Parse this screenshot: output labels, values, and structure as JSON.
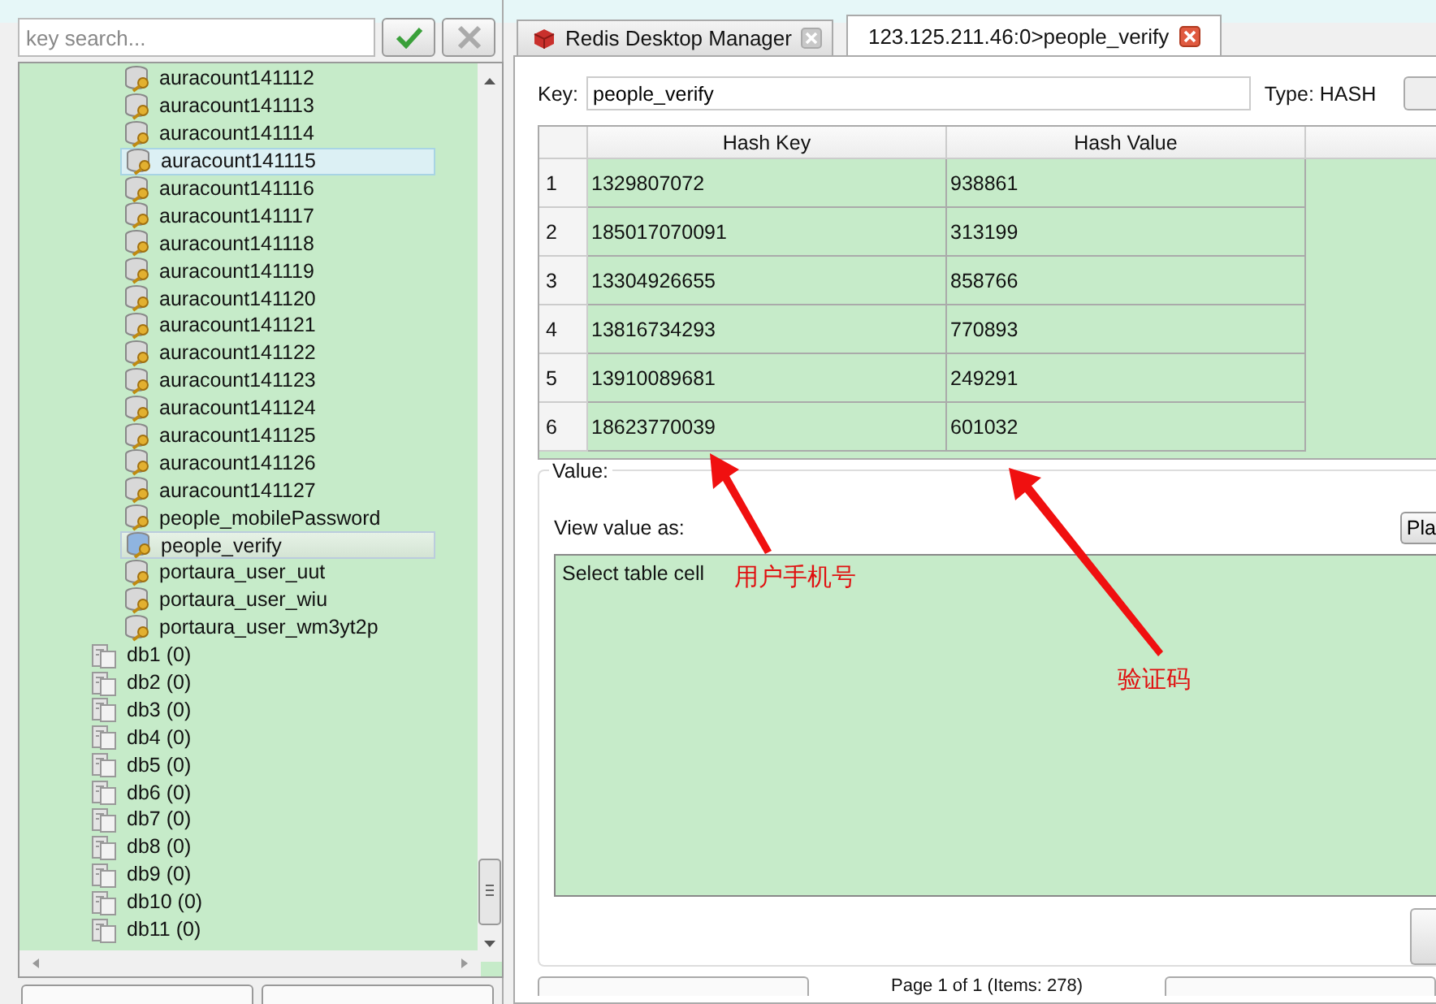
{
  "search": {
    "placeholder": "key search..."
  },
  "tree": {
    "keys": [
      {
        "label": "auracount141112",
        "selected": false,
        "hover": false
      },
      {
        "label": "auracount141113",
        "selected": false,
        "hover": false
      },
      {
        "label": "auracount141114",
        "selected": false,
        "hover": false
      },
      {
        "label": "auracount141115",
        "selected": false,
        "hover": true
      },
      {
        "label": "auracount141116",
        "selected": false,
        "hover": false
      },
      {
        "label": "auracount141117",
        "selected": false,
        "hover": false
      },
      {
        "label": "auracount141118",
        "selected": false,
        "hover": false
      },
      {
        "label": "auracount141119",
        "selected": false,
        "hover": false
      },
      {
        "label": "auracount141120",
        "selected": false,
        "hover": false
      },
      {
        "label": "auracount141121",
        "selected": false,
        "hover": false
      },
      {
        "label": "auracount141122",
        "selected": false,
        "hover": false
      },
      {
        "label": "auracount141123",
        "selected": false,
        "hover": false
      },
      {
        "label": "auracount141124",
        "selected": false,
        "hover": false
      },
      {
        "label": "auracount141125",
        "selected": false,
        "hover": false
      },
      {
        "label": "auracount141126",
        "selected": false,
        "hover": false
      },
      {
        "label": "auracount141127",
        "selected": false,
        "hover": false
      },
      {
        "label": "people_mobilePassword",
        "selected": false,
        "hover": false
      },
      {
        "label": "people_verify",
        "selected": true,
        "hover": false
      },
      {
        "label": "portaura_user_uut",
        "selected": false,
        "hover": false
      },
      {
        "label": "portaura_user_wiu",
        "selected": false,
        "hover": false
      },
      {
        "label": "portaura_user_wm3yt2p",
        "selected": false,
        "hover": false
      }
    ],
    "databases": [
      {
        "label": "db1 (0)"
      },
      {
        "label": "db2 (0)"
      },
      {
        "label": "db3 (0)"
      },
      {
        "label": "db4 (0)"
      },
      {
        "label": "db5 (0)"
      },
      {
        "label": "db6 (0)"
      },
      {
        "label": "db7 (0)"
      },
      {
        "label": "db8 (0)"
      },
      {
        "label": "db9 (0)"
      },
      {
        "label": "db10 (0)"
      },
      {
        "label": "db11 (0)"
      }
    ]
  },
  "tabs": [
    {
      "label": "Redis Desktop Manager",
      "selected": false,
      "kind": "home"
    },
    {
      "label": "123.125.211.46:0>people_verify",
      "selected": true,
      "kind": "key"
    }
  ],
  "key_row": {
    "label": "Key:",
    "value": "people_verify",
    "type": "Type: HASH"
  },
  "table": {
    "columns": [
      "Hash Key",
      "Hash Value"
    ],
    "rows": [
      {
        "number": "1",
        "key": "1329807072",
        "value": "938861"
      },
      {
        "number": "2",
        "key": "185017070091",
        "value": "313199"
      },
      {
        "number": "3",
        "key": "13304926655",
        "value": "858766"
      },
      {
        "number": "4",
        "key": "13816734293",
        "value": "770893"
      },
      {
        "number": "5",
        "key": "13910089681",
        "value": "249291"
      },
      {
        "number": "6",
        "key": "18623770039",
        "value": "601032"
      }
    ]
  },
  "value_group": {
    "title": "Value:",
    "view_as": "View value as:",
    "format_button": "Pla",
    "text": "Select table cell"
  },
  "pagination": "Page 1 of 1 (Items: 278)",
  "annotations": [
    {
      "text": "用户手机号"
    },
    {
      "text": "验证码"
    }
  ]
}
